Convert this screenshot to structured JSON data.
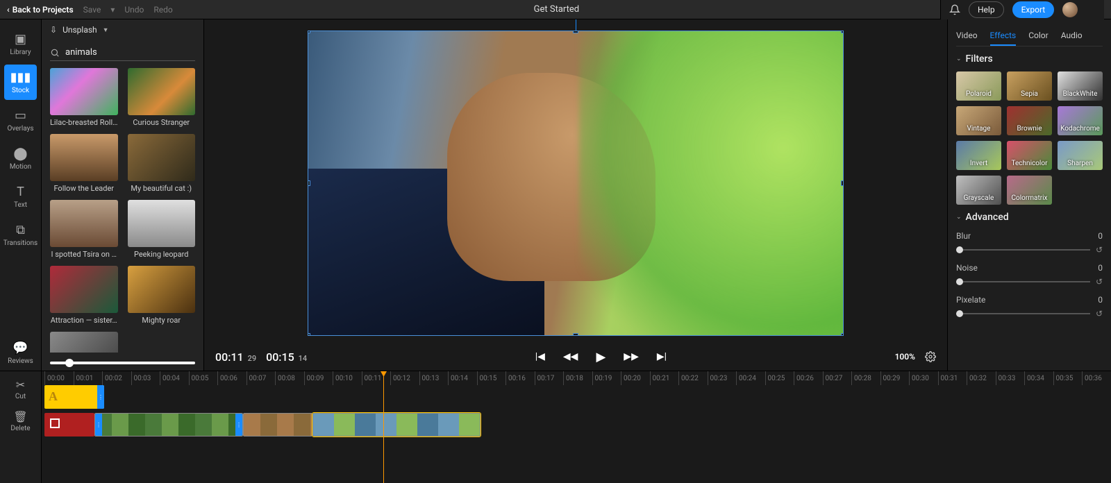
{
  "topbar": {
    "back": "Back to Projects",
    "save": "Save",
    "undo": "Undo",
    "redo": "Redo",
    "title": "Get Started",
    "help": "Help",
    "export": "Export"
  },
  "rail": {
    "library": "Library",
    "stock": "Stock",
    "overlays": "Overlays",
    "motion": "Motion",
    "text": "Text",
    "transitions": "Transitions",
    "reviews": "Reviews"
  },
  "library": {
    "source": "Unsplash",
    "search_value": "animals",
    "search_placeholder": "Search",
    "items": [
      {
        "label": "Lilac-breasted Roll…"
      },
      {
        "label": "Curious Stranger"
      },
      {
        "label": "Follow the Leader"
      },
      {
        "label": "My beautiful cat :)"
      },
      {
        "label": "I spotted Tsira on …"
      },
      {
        "label": "Peeking leopard"
      },
      {
        "label": "Attraction — sister…"
      },
      {
        "label": "Mighty roar"
      }
    ]
  },
  "preview": {
    "current_time": "00:11",
    "current_frames": "29",
    "total_time": "00:15",
    "total_frames": "14",
    "zoom": "100%"
  },
  "right_tabs": {
    "video": "Video",
    "effects": "Effects",
    "color": "Color",
    "audio": "Audio"
  },
  "filters": {
    "title": "Filters",
    "items": [
      "Polaroid",
      "Sepia",
      "BlackWhite",
      "Vintage",
      "Brownie",
      "Kodachrome",
      "Invert",
      "Technicolor",
      "Sharpen",
      "Grayscale",
      "Colormatrix"
    ]
  },
  "advanced": {
    "title": "Advanced",
    "blur": {
      "label": "Blur",
      "value": "0"
    },
    "noise": {
      "label": "Noise",
      "value": "0"
    },
    "pixelate": {
      "label": "Pixelate",
      "value": "0"
    }
  },
  "timeline": {
    "tools": {
      "cut": "Cut",
      "delete": "Delete"
    },
    "ticks": [
      "00:00",
      "00:01",
      "00:02",
      "00:03",
      "00:04",
      "00:05",
      "00:06",
      "00:07",
      "00:08",
      "00:09",
      "00:10",
      "00:11",
      "00:12",
      "00:13",
      "00:14",
      "00:15",
      "00:16",
      "00:17",
      "00:18",
      "00:19",
      "00:20",
      "00:21",
      "00:22",
      "00:23",
      "00:24",
      "00:25",
      "00:26",
      "00:27",
      "00:28",
      "00:29",
      "00:30",
      "00:31",
      "00:32",
      "00:33",
      "00:34",
      "00:35",
      "00:36"
    ]
  }
}
